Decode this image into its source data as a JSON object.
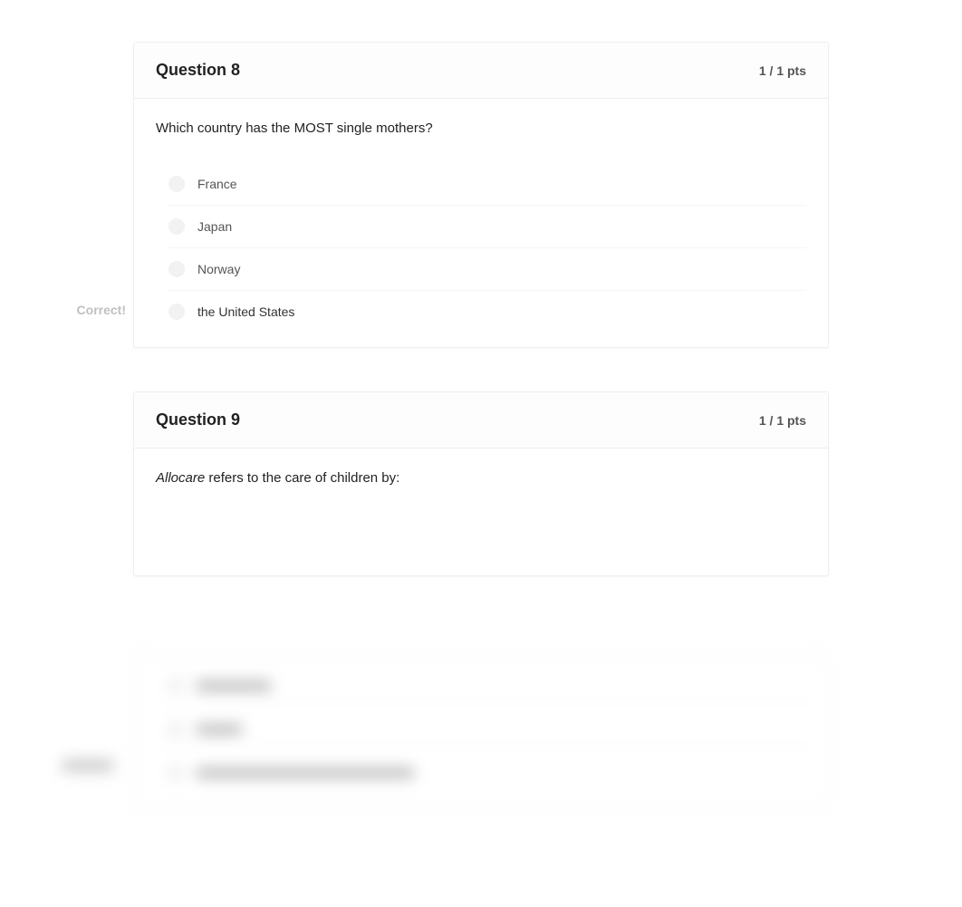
{
  "question8": {
    "title": "Question 8",
    "points": "1 / 1 pts",
    "prompt": "Which country has the MOST single mothers?",
    "answers": {
      "a": "France",
      "b": "Japan",
      "c": "Norway",
      "d": "the United States"
    },
    "correct_label": "Correct!"
  },
  "question9": {
    "title": "Question 9",
    "points": "1 / 1 pts",
    "prompt_italic": "Allocare",
    "prompt_rest": " refers to the care of children by:"
  }
}
